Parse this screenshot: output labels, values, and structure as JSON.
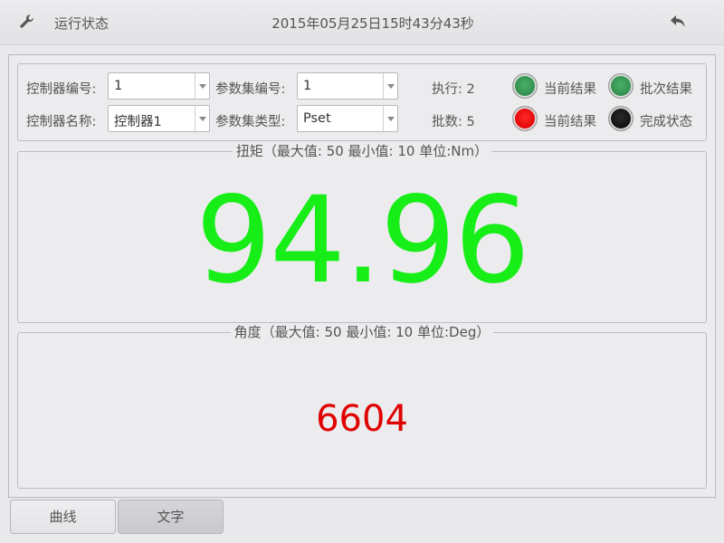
{
  "header": {
    "title": "运行状态",
    "datetime": "2015年05月25日15时43分43秒",
    "icons": {
      "left": "wrench-icon",
      "right": "back-arrow-icon"
    }
  },
  "controls": {
    "controller_no_label": "控制器编号:",
    "controller_no_value": "1",
    "controller_name_label": "控制器名称:",
    "controller_name_value": "控制器1",
    "paramset_no_label": "参数集编号:",
    "paramset_no_value": "1",
    "paramset_type_label": "参数集类型:",
    "paramset_type_value": "Pset",
    "exec_text": "执行: 2",
    "batch_text": "批数: 5",
    "status_row1": [
      {
        "label": "当前结果",
        "color": "green"
      },
      {
        "label": "批次结果",
        "color": "green"
      }
    ],
    "status_row2": [
      {
        "label": "当前结果",
        "color": "red"
      },
      {
        "label": "完成状态",
        "color": "black"
      }
    ]
  },
  "torque": {
    "legend": "扭矩（最大值: 50  最小值: 10  单位:Nm）",
    "value": "94.96",
    "color": "#17ee17"
  },
  "angle": {
    "legend": "角度（最大值: 50  最小值: 10  单位:Deg）",
    "value": "6604",
    "color": "#e00000"
  },
  "tabs": [
    {
      "label": "曲线",
      "active": false
    },
    {
      "label": "文字",
      "active": true
    }
  ]
}
